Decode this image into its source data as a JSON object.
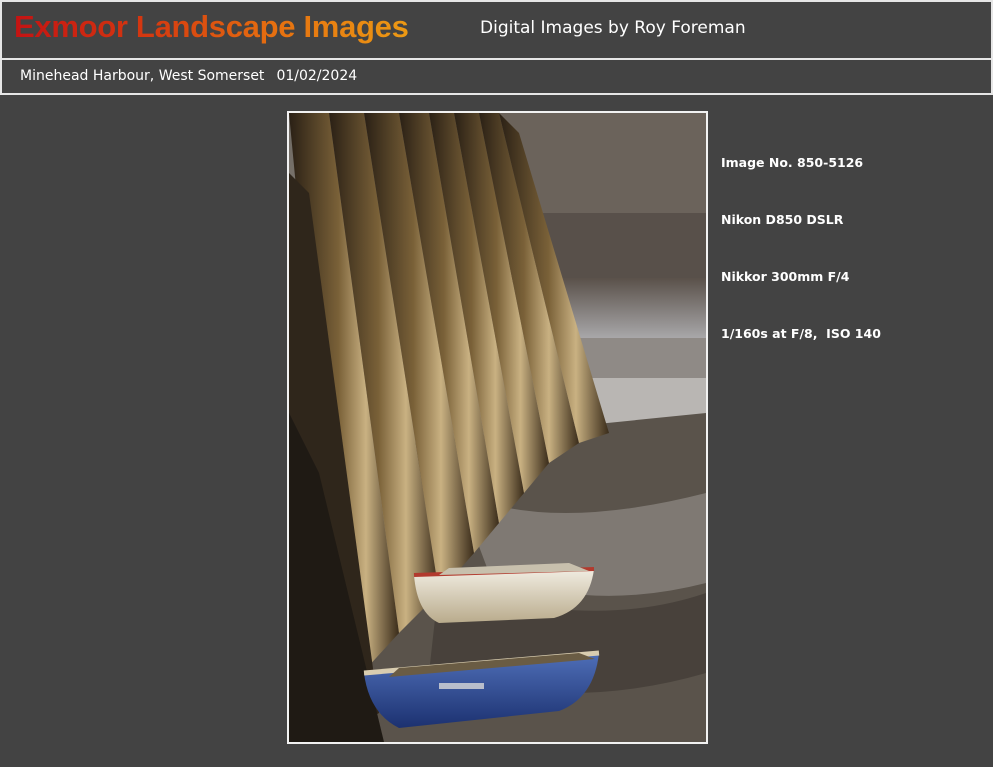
{
  "header": {
    "site_title": "Exmoor Landscape Images",
    "site_subtitle": "Digital Images by Roy Foreman"
  },
  "caption": {
    "location": "Minehead Harbour, West Somerset",
    "date": "01/02/2024"
  },
  "photo": {
    "subject": "harbour-wall-with-rowing-boats"
  },
  "details": {
    "image_no": "Image No. 850-5126",
    "camera": "Nikon D850 DSLR",
    "lens": "Nikkor 300mm F/4",
    "exposure": "1/160s at F/8,  ISO 140"
  },
  "colors": {
    "background": "#434343",
    "rule": "#e6e6e6",
    "title_gradient_start": "#c41313",
    "title_gradient_end": "#ec9a14"
  }
}
